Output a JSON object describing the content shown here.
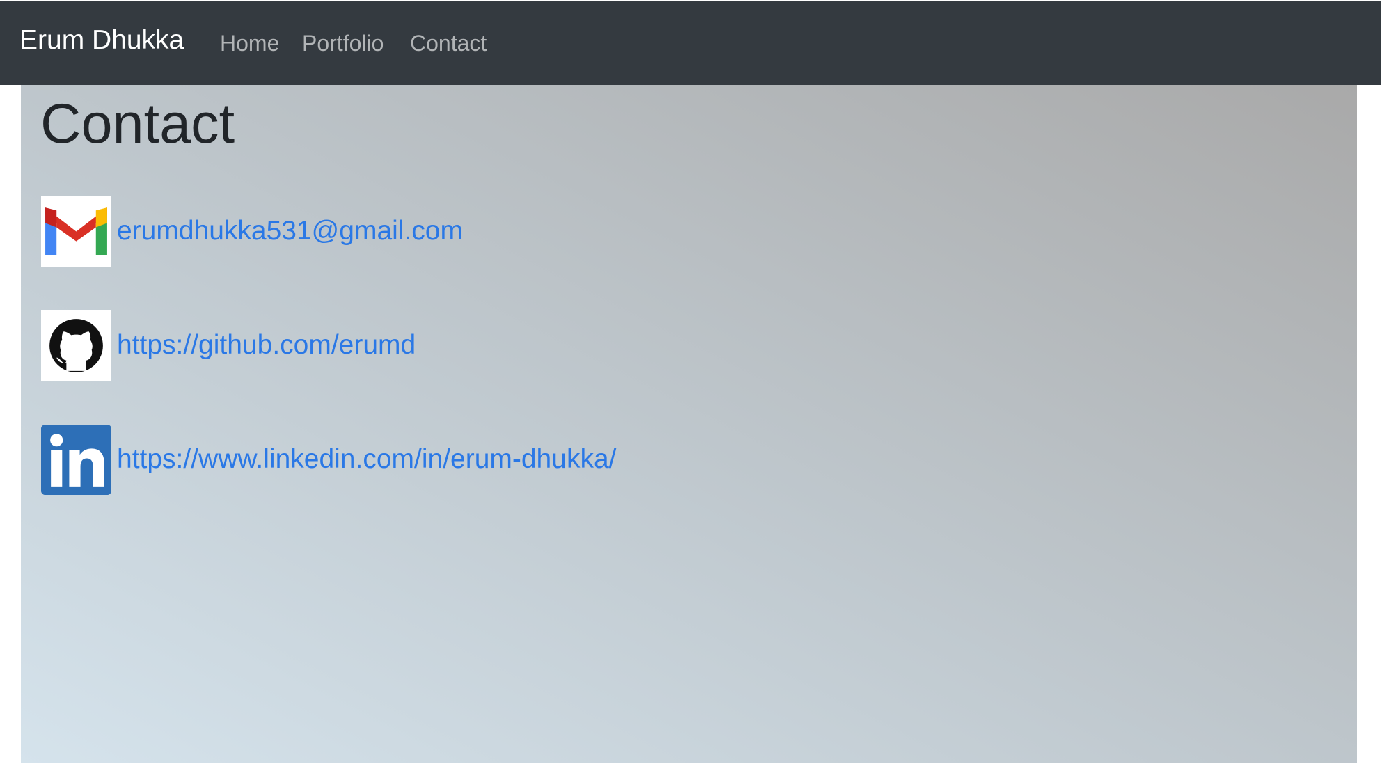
{
  "navbar": {
    "brand": "Erum Dhukka",
    "links": [
      {
        "label": "Home"
      },
      {
        "label": "Portfolio"
      },
      {
        "label": "Contact"
      }
    ],
    "background": "#343a40"
  },
  "main": {
    "title": "Contact",
    "contacts": [
      {
        "icon": "gmail-icon",
        "text": "erumdhukka531@gmail.com"
      },
      {
        "icon": "github-icon",
        "text": "https://github.com/erumd"
      },
      {
        "icon": "linkedin-icon",
        "text": "https://www.linkedin.com/in/erum-dhukka/"
      }
    ]
  },
  "colors": {
    "link": "#2a78e6",
    "title": "#212529",
    "linkedin_brand": "#2d6fb7"
  }
}
